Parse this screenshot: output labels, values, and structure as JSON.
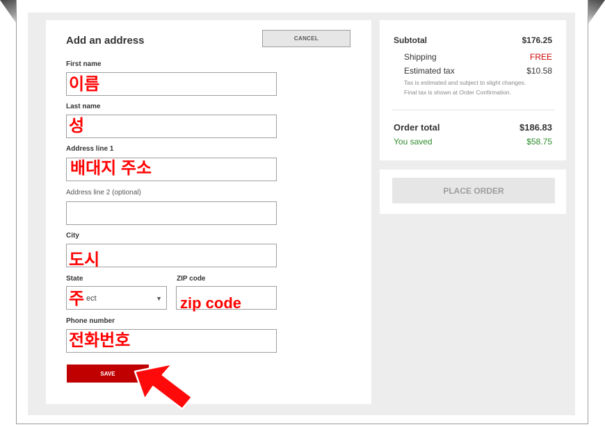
{
  "form": {
    "title": "Add an address",
    "cancel_label": "CANCEL",
    "fields": {
      "first_name": {
        "label": "First name",
        "overlay": "이름"
      },
      "last_name": {
        "label": "Last name",
        "overlay": "성"
      },
      "address1": {
        "label": "Address line 1",
        "overlay": "배대지 주소"
      },
      "address2": {
        "label": "Address line 2 (optional)"
      },
      "city": {
        "label": "City",
        "overlay": "도시"
      },
      "state": {
        "label": "State",
        "selected": "ect",
        "overlay": "주"
      },
      "zip": {
        "label": "ZIP code",
        "overlay": "zip code"
      },
      "phone": {
        "label": "Phone number",
        "overlay": "전화번호"
      }
    },
    "save_label": "SAVE"
  },
  "summary": {
    "subtotal_label": "Subtotal",
    "subtotal_value": "$176.25",
    "shipping_label": "Shipping",
    "shipping_value": "FREE",
    "tax_label": "Estimated tax",
    "tax_value": "$10.58",
    "tax_note_1": "Tax is estimated and subject to slight changes.",
    "tax_note_2": "Final tax is shown at Order Confirmation.",
    "total_label": "Order total",
    "total_value": "$186.83",
    "saved_label": "You saved",
    "saved_value": "$58.75"
  },
  "place_order_label": "PLACE ORDER",
  "colors": {
    "accent_red": "#c00000",
    "annotation_red": "#ff0000",
    "saved_green": "#2e8b2e",
    "free_red": "#cc0000"
  }
}
